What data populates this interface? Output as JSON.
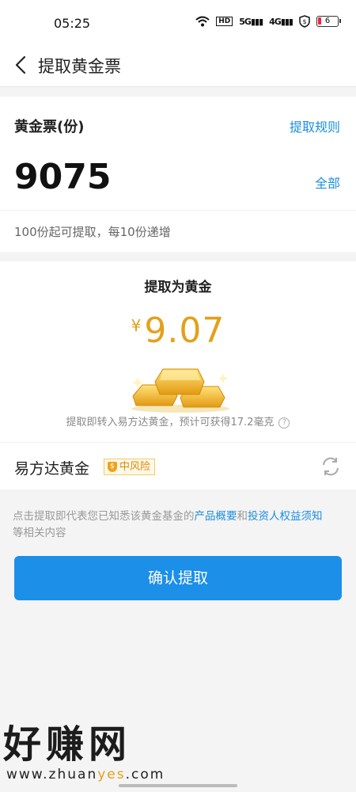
{
  "status_bar": {
    "time": "05:25",
    "hd": "HD",
    "net1": "5G",
    "net2": "4G",
    "battery": "6"
  },
  "header": {
    "title": "提取黄金票"
  },
  "balance": {
    "label": "黄金票(份)",
    "rules_link": "提取规则",
    "amount": "9075",
    "all_link": "全部",
    "hint": "100份起可提取，每10份递增"
  },
  "convert": {
    "title": "提取为黄金",
    "currency": "¥",
    "value": "9.07",
    "note": "提取即转入易方达黄金，预计可获得17.2毫克",
    "info_icon": "?"
  },
  "fund": {
    "name": "易方达黄金",
    "risk": "中风险",
    "risk_icon": "$"
  },
  "disclaimer": {
    "pre": "点击提取即代表您已知悉该黄金基金的",
    "link1": "产品概要",
    "mid": "和",
    "link2": "投资人权益须知",
    "post": "等相关内容"
  },
  "confirm_button": "确认提取",
  "watermark": {
    "big": "好赚网",
    "small_pre": "www.zhuan",
    "small_hl": "yes",
    "small_post": ".com"
  },
  "colors": {
    "accent": "#1c8fe8",
    "link": "#1a8ee0",
    "gold": "#e4a01c"
  }
}
